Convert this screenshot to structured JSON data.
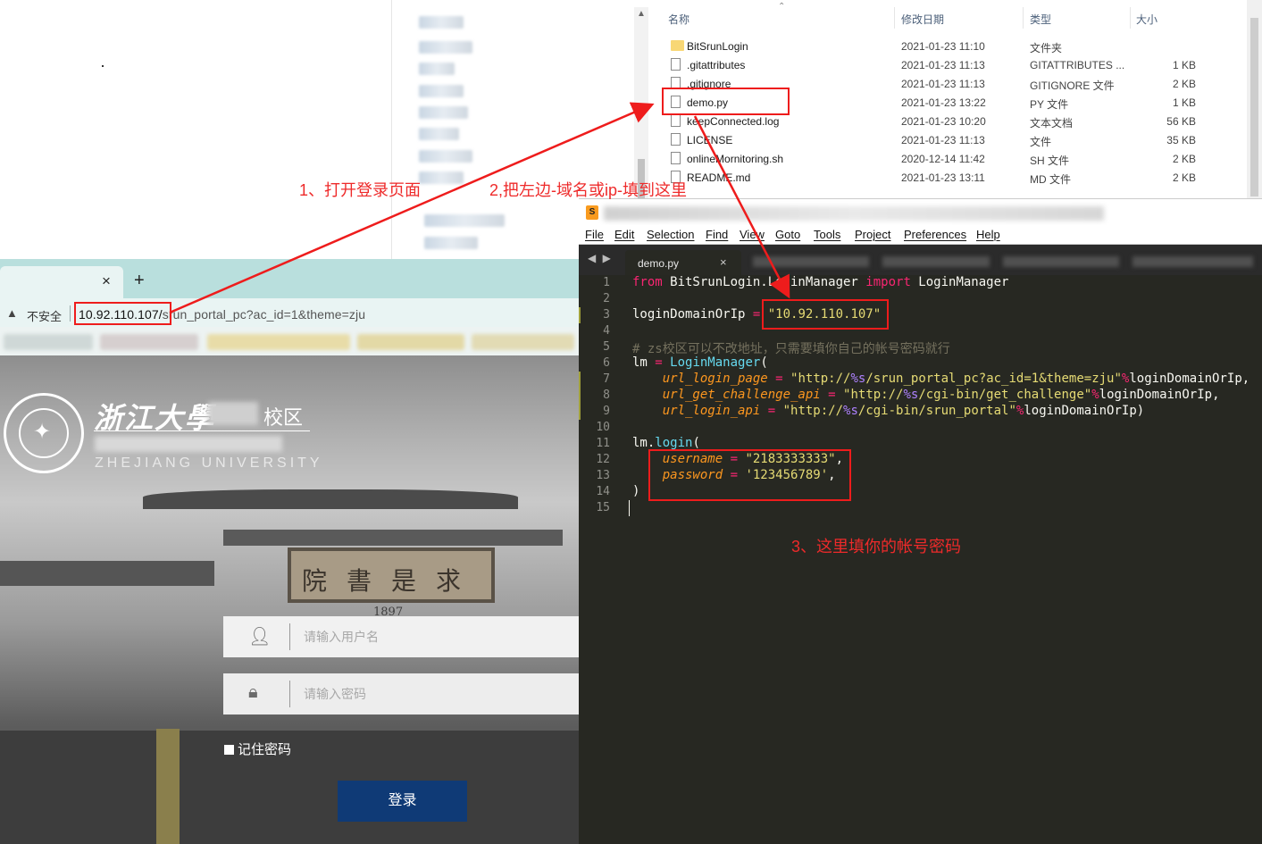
{
  "explorer": {
    "columns": {
      "name": "名称",
      "date": "修改日期",
      "type": "类型",
      "size": "大小"
    },
    "files": [
      {
        "name": "BitSrunLogin",
        "date": "2021-01-23 11:10",
        "type": "文件夹",
        "size": "",
        "icon": "folder-icon"
      },
      {
        "name": ".gitattributes",
        "date": "2021-01-23 11:13",
        "type": "GITATTRIBUTES ...",
        "size": "1 KB",
        "icon": "file-icon"
      },
      {
        "name": ".gitignore",
        "date": "2021-01-23 11:13",
        "type": "GITIGNORE 文件",
        "size": "2 KB",
        "icon": "file-icon"
      },
      {
        "name": "demo.py",
        "date": "2021-01-23 13:22",
        "type": "PY 文件",
        "size": "1 KB",
        "icon": "file-icon"
      },
      {
        "name": "keepConnected.log",
        "date": "2021-01-23 10:20",
        "type": "文本文档",
        "size": "56 KB",
        "icon": "file-icon"
      },
      {
        "name": "LICENSE",
        "date": "2021-01-23 11:13",
        "type": "文件",
        "size": "35 KB",
        "icon": "file-icon"
      },
      {
        "name": "onlineMornitoring.sh",
        "date": "2020-12-14 11:42",
        "type": "SH 文件",
        "size": "2 KB",
        "icon": "file-icon"
      },
      {
        "name": "README.md",
        "date": "2021-01-23 13:11",
        "type": "MD 文件",
        "size": "2 KB",
        "icon": "file-icon"
      }
    ]
  },
  "browser": {
    "tab_close": "×",
    "new_tab": "+",
    "not_secure": "不安全",
    "url_host": "10.92.110.107/",
    "url_path": "srun_portal_pc?ac_id=1&theme=zju",
    "page": {
      "univ_cn": "浙江大學",
      "campus_label": "校区",
      "univ_en": "ZHEJIANG UNIVERSITY",
      "plaque": "院書是求",
      "plaque_year": "1897",
      "username_placeholder": "请输入用户名",
      "password_placeholder": "请输入密码",
      "remember": "记住密码",
      "login_button": "登录"
    }
  },
  "editor": {
    "menu": [
      "File",
      "Edit",
      "Selection",
      "Find",
      "View",
      "Goto",
      "Tools",
      "Project",
      "Preferences",
      "Help"
    ],
    "tab_label": "demo.py",
    "tab_close": "×",
    "line_numbers": [
      "1",
      "2",
      "3",
      "4",
      "5",
      "6",
      "7",
      "8",
      "9",
      "10",
      "11",
      "12",
      "13",
      "14",
      "15"
    ],
    "code": {
      "l1_from": "from",
      "l1_mod": " BitSrunLogin.LoginManager ",
      "l1_import": "import",
      "l1_name": " LoginManager",
      "l3_var": "loginDomainOrIp",
      "l3_eq": " = ",
      "l3_val": "\"10.92.110.107\"",
      "l5_comment": "# zs校区可以不改地址，只需要填你自己的帐号密码就行",
      "l6_lm": "lm",
      "l6_eq": " = ",
      "l6_cls": "LoginManager",
      "l6_paren": "(",
      "l7_arg": "url_login_page",
      "l7_str1": "\"http://",
      "l7_fmt": "%s",
      "l7_str2": "/srun_portal_pc?ac_id=1&theme=zju\"",
      "l7_rest": "loginDomainOrIp,",
      "l8_arg": "url_get_challenge_api",
      "l8_str1": "\"http://",
      "l8_fmt": "%s",
      "l8_str2": "/cgi-bin/get_challenge\"",
      "l8_rest": "loginDomainOrIp,",
      "l9_arg": "url_login_api",
      "l9_str1": "\"http://",
      "l9_fmt": "%s",
      "l9_str2": "/cgi-bin/srun_portal\"",
      "l9_rest": "loginDomainOrIp)",
      "l11_lm": "lm.",
      "l11_fn": "login",
      "l11_paren": "(",
      "l12_arg": "username",
      "l12_val": "\"2183333333\"",
      "l13_arg": "password",
      "l13_val": "'123456789'",
      "l14_paren": ")"
    }
  },
  "annotations": {
    "step1": "1、打开登录页面",
    "step2": "2,把左边-域名或ip-填到这里",
    "step3": "3、这里填你的帐号密码"
  },
  "colors": {
    "annotation_red": "#ee1c1c",
    "login_button": "#0f3a76",
    "editor_bg": "#272822",
    "browser_tab_bar": "#b9dfdd"
  }
}
